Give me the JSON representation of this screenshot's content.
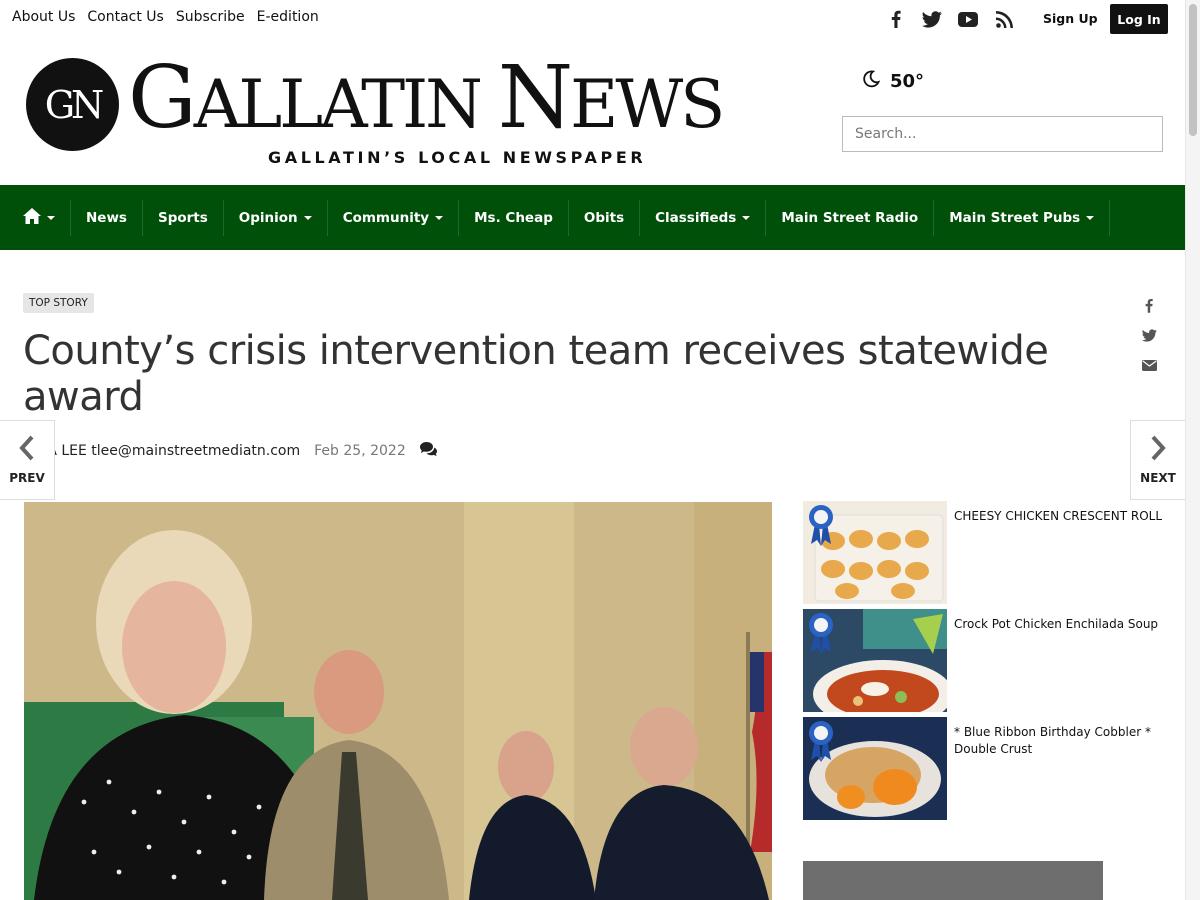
{
  "toplinks": [
    "About Us",
    "Contact Us",
    "Subscribe",
    "E-edition"
  ],
  "social_icons": [
    "facebook-icon",
    "twitter-icon",
    "youtube-icon",
    "rss-icon"
  ],
  "account": {
    "signup": "Sign Up",
    "login": "Log In"
  },
  "masthead": {
    "logo_mark": "GN",
    "title_parts": [
      "G",
      "ALLATIN ",
      "N",
      "EWS"
    ],
    "tagline": "GALLATIN’S LOCAL NEWSPAPER"
  },
  "weather": {
    "icon": "moon-icon",
    "temp": "50°"
  },
  "search": {
    "placeholder": "Search..."
  },
  "nav": {
    "home_icon": "home-icon",
    "items": [
      {
        "label": "News",
        "dropdown": false
      },
      {
        "label": "Sports",
        "dropdown": false
      },
      {
        "label": "Opinion",
        "dropdown": true
      },
      {
        "label": "Community",
        "dropdown": true
      },
      {
        "label": "Ms. Cheap",
        "dropdown": false
      },
      {
        "label": "Obits",
        "dropdown": false
      },
      {
        "label": "Classifieds",
        "dropdown": true
      },
      {
        "label": "Main Street Radio",
        "dropdown": false
      },
      {
        "label": "Main Street Pubs",
        "dropdown": true
      }
    ]
  },
  "article": {
    "badge": "TOP STORY",
    "headline": "County’s crisis intervention team receives statewide award",
    "author": "ENA LEE tlee@mainstreetmediatn.com",
    "date": "Feb 25, 2022",
    "comments_icon": "comments-icon"
  },
  "share_icons": [
    "facebook-share-icon",
    "twitter-share-icon",
    "email-share-icon"
  ],
  "pager": {
    "prev": "PREV",
    "next": "NEXT"
  },
  "sidebar": {
    "items": [
      {
        "title": "CHEESY CHICKEN CRESCENT ROLL"
      },
      {
        "title": "Crock Pot Chicken Enchilada Soup"
      },
      {
        "title": "* Blue Ribbon Birthday Cobbler * Double Crust"
      }
    ]
  },
  "colors": {
    "nav_bg": "#00500a",
    "login_bg": "#111111"
  }
}
